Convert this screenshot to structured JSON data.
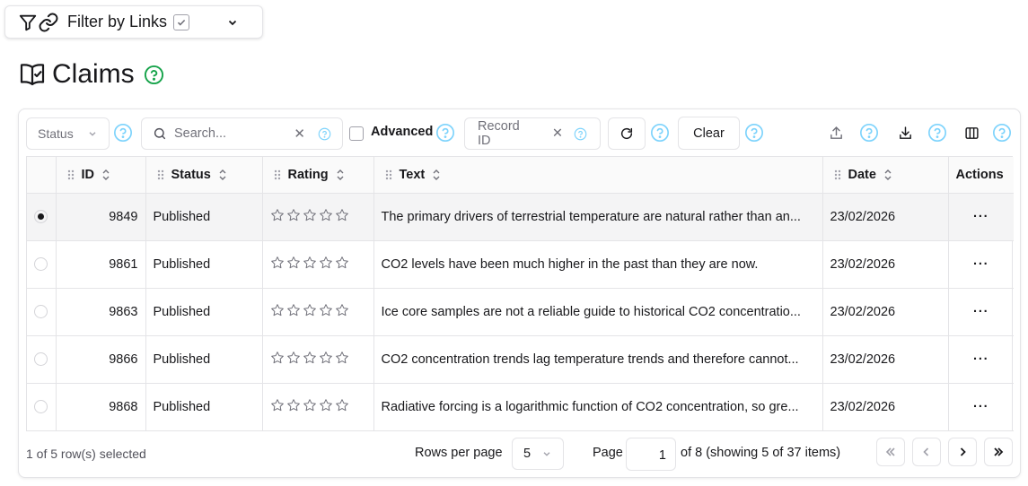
{
  "filter": {
    "label": "Filter by Links",
    "checked": true
  },
  "page": {
    "title": "Claims"
  },
  "toolbar": {
    "status_placeholder": "Status",
    "search_placeholder": "Search...",
    "advanced_label": "Advanced",
    "record_placeholder": "Record ID",
    "clear_label": "Clear"
  },
  "table": {
    "columns": [
      {
        "key": "id",
        "label": "ID"
      },
      {
        "key": "status",
        "label": "Status"
      },
      {
        "key": "rating",
        "label": "Rating"
      },
      {
        "key": "text",
        "label": "Text"
      },
      {
        "key": "date",
        "label": "Date"
      },
      {
        "key": "actions",
        "label": "Actions"
      }
    ],
    "rows": [
      {
        "selected": true,
        "id": "9849",
        "status": "Published",
        "rating": 0,
        "text": "The primary drivers of terrestrial temperature are natural rather than an...",
        "date": "23/02/2026",
        "actions": "···"
      },
      {
        "selected": false,
        "id": "9861",
        "status": "Published",
        "rating": 0,
        "text": "CO2 levels have been much higher in the past than they are now.",
        "date": "23/02/2026",
        "actions": "···"
      },
      {
        "selected": false,
        "id": "9863",
        "status": "Published",
        "rating": 0,
        "text": "Ice core samples are not a reliable guide to historical CO2 concentratio...",
        "date": "23/02/2026",
        "actions": "···"
      },
      {
        "selected": false,
        "id": "9866",
        "status": "Published",
        "rating": 0,
        "text": "CO2 concentration trends lag temperature trends and therefore cannot...",
        "date": "23/02/2026",
        "actions": "···"
      },
      {
        "selected": false,
        "id": "9868",
        "status": "Published",
        "rating": 0,
        "text": "Radiative forcing is a logarithmic function of CO2 concentration, so gre...",
        "date": "23/02/2026",
        "actions": "···"
      }
    ]
  },
  "footer": {
    "selection_info": "1 of 5 row(s) selected",
    "rows_per_page_label": "Rows per page",
    "rows_per_page_value": "5",
    "page_label": "Page",
    "page_value": "1",
    "page_of_text": "of 8 (showing 5 of 37 items)"
  },
  "colors": {
    "help_blue": "#7dd3fc",
    "help_green": "#16a34a",
    "border": "#e4e4e7"
  }
}
